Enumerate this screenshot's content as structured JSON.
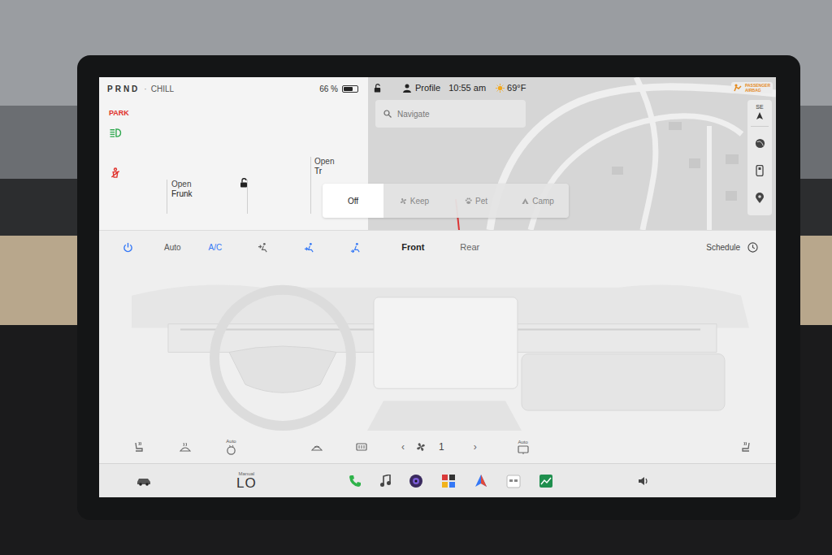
{
  "status": {
    "gear": "PRND",
    "separator": "·",
    "mode": "CHILL",
    "battery": "66 %",
    "battery_level": 0.66
  },
  "indicators": [
    {
      "kind": "text",
      "label": "PARK",
      "color": "#e0312b"
    },
    {
      "kind": "headlight",
      "color": "#2fa84f"
    },
    {
      "kind": "seatbelt",
      "color": "#e0312b"
    }
  ],
  "car_panel": {
    "locked": false,
    "frunk": {
      "action": "Open",
      "label": "Frunk"
    },
    "trunk": {
      "action": "Open",
      "label": "Tr"
    }
  },
  "top_bar": {
    "locked": false,
    "profile": "Profile",
    "time": "10:55 am",
    "temperature": "69°F",
    "airbag_badge": [
      "PASSENGER",
      "AIRBAG"
    ]
  },
  "search": {
    "placeholder": "Navigate"
  },
  "map": {
    "compass": "SE"
  },
  "climate_keeper": [
    {
      "label": "Off",
      "selected": true
    },
    {
      "label": "Keep",
      "selected": false
    },
    {
      "label": "Pet",
      "selected": false
    },
    {
      "label": "Camp",
      "selected": false
    }
  ],
  "climate": {
    "power_on": true,
    "auto": {
      "label": "Auto",
      "on": false
    },
    "ac": {
      "label": "A/C",
      "on": true
    },
    "airflow": [
      {
        "on": false
      },
      {
        "on": true
      },
      {
        "on": true
      }
    ],
    "zones": [
      {
        "label": "Front",
        "selected": true
      },
      {
        "label": "Rear",
        "selected": false
      }
    ],
    "schedule": "Schedule"
  },
  "seat_controls": {
    "steering_auto": "Auto",
    "defrost_auto": "Auto",
    "fan_left": "‹",
    "fan_speed": "1",
    "fan_right": "›"
  },
  "bottom_bar": {
    "temp_mode": "Manual",
    "temperature": "LO"
  }
}
